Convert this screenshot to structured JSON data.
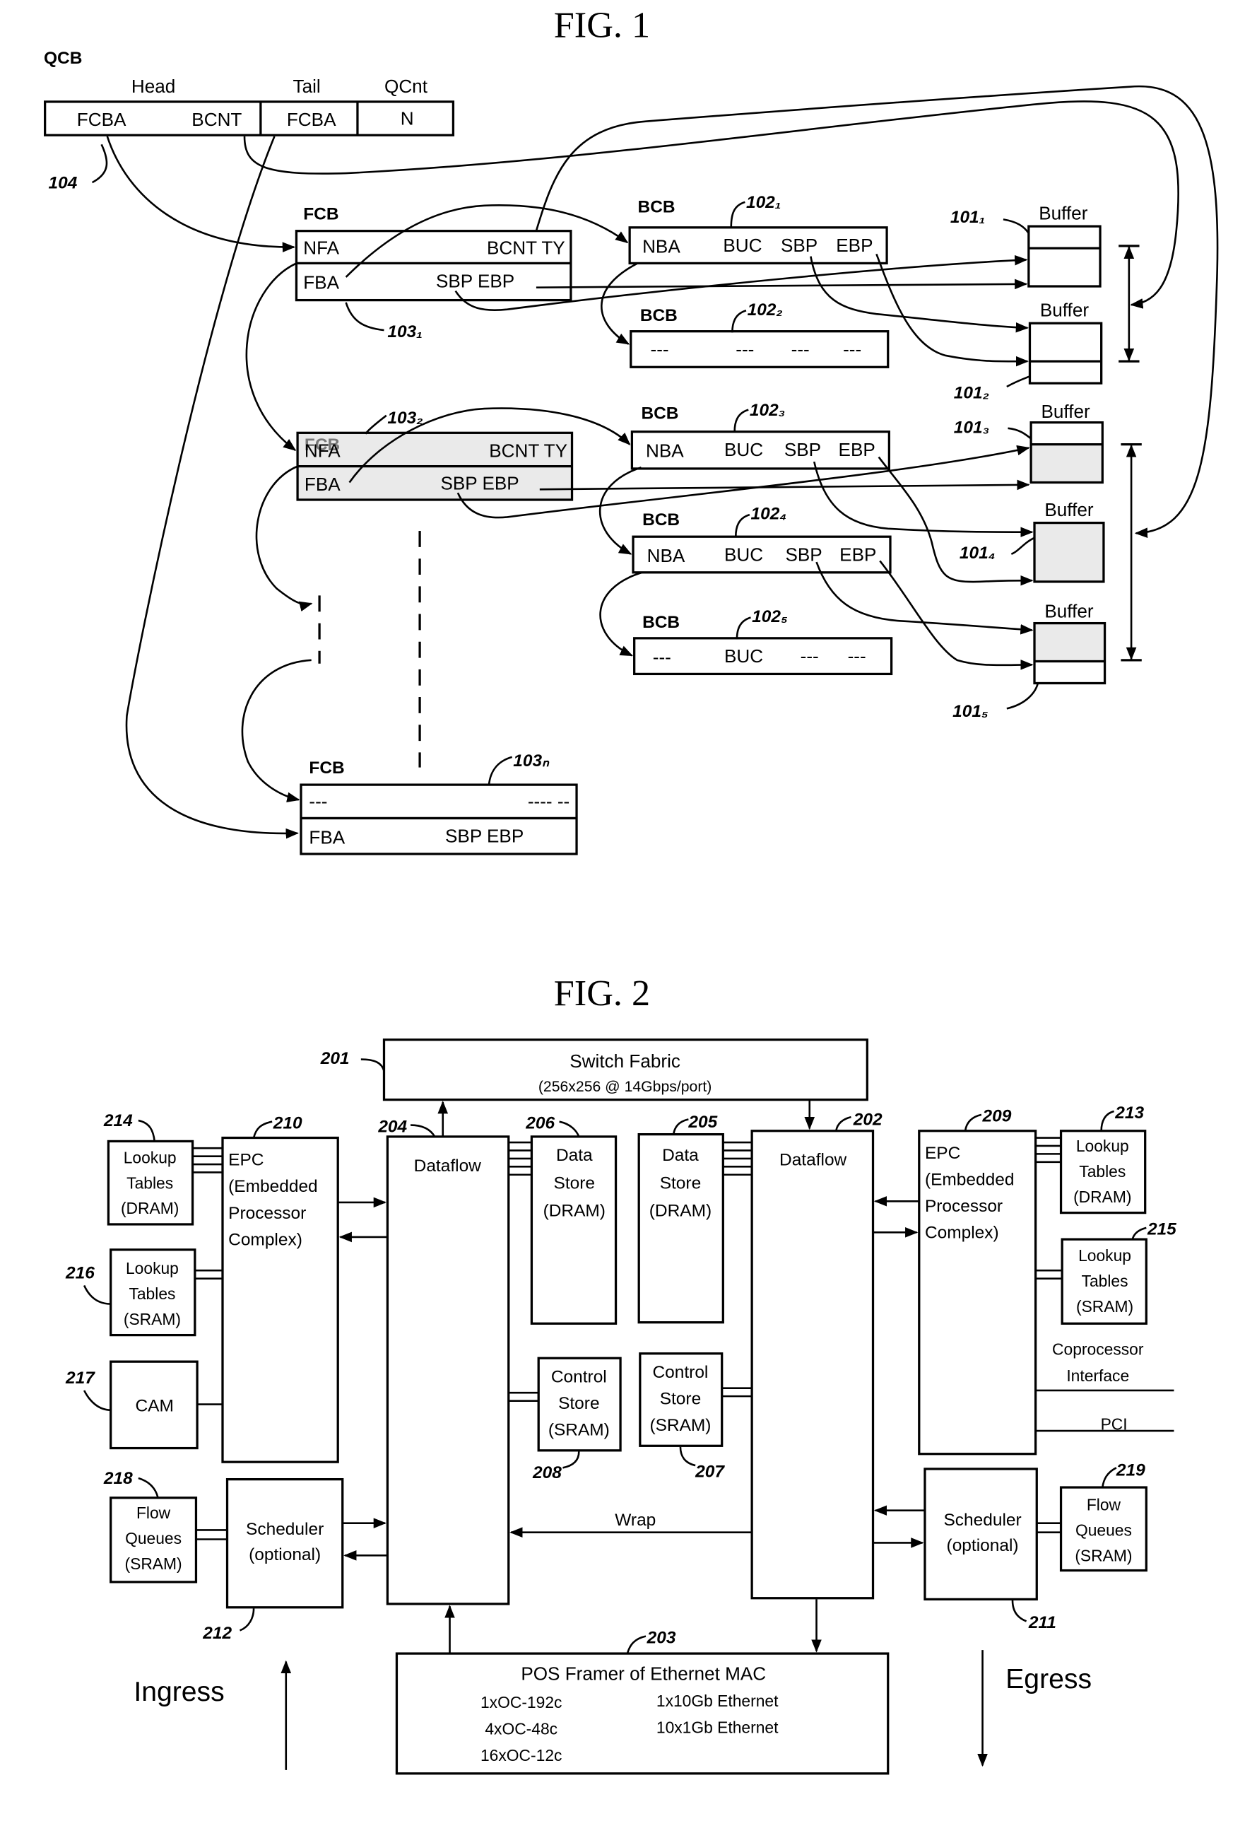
{
  "fig1": {
    "title": "FIG. 1",
    "qcb": {
      "label": "QCB",
      "headers": {
        "head": "Head",
        "tail": "Tail",
        "qcnt": "QCnt"
      },
      "fields": [
        "FCBA",
        "BCNT",
        "FCBA",
        "N"
      ],
      "ref": "104"
    },
    "fcbs": [
      {
        "label": "FCB",
        "ref": "103₁",
        "row1": [
          "NFA",
          "BCNT TY"
        ],
        "row2": [
          "FBA",
          "SBP EBP"
        ],
        "shaded": false
      },
      {
        "label": "FCB",
        "ref": "103₂",
        "row1": [
          "NFA",
          "BCNT TY"
        ],
        "row2": [
          "FBA",
          "SBP EBP"
        ],
        "shaded": true
      },
      {
        "label": "FCB",
        "ref": "103ₙ",
        "row1": [
          "---",
          "---- --"
        ],
        "row2": [
          "FBA",
          "SBP EBP"
        ],
        "shaded": false
      }
    ],
    "bcbs": [
      {
        "label": "BCB",
        "ref": "102₁",
        "fields": [
          "NBA",
          "BUC",
          "SBP",
          "EBP"
        ]
      },
      {
        "label": "BCB",
        "ref": "102₂",
        "fields": [
          "---",
          "---",
          "---",
          "---"
        ]
      },
      {
        "label": "BCB",
        "ref": "102₃",
        "fields": [
          "NBA",
          "BUC",
          "SBP",
          "EBP"
        ]
      },
      {
        "label": "BCB",
        "ref": "102₄",
        "fields": [
          "NBA",
          "BUC",
          "SBP",
          "EBP"
        ]
      },
      {
        "label": "BCB",
        "ref": "102₅",
        "fields": [
          "---",
          "BUC",
          "---",
          "---"
        ]
      }
    ],
    "buffers": [
      {
        "label": "Buffer",
        "ref": "101₁"
      },
      {
        "label": "Buffer",
        "ref": "101₂"
      },
      {
        "label": "Buffer",
        "ref": "101₃"
      },
      {
        "label": "Buffer",
        "ref": "101₄"
      },
      {
        "label": "Buffer",
        "ref": "101₅"
      }
    ]
  },
  "fig2": {
    "title": "FIG. 2",
    "switch_fabric": {
      "ref": "201",
      "title": "Switch Fabric",
      "subtitle": "(256x256 @ 14Gbps/port)"
    },
    "dataflow_ingress": {
      "ref": "204",
      "label": "Dataflow"
    },
    "dataflow_egress": {
      "ref": "202",
      "label": "Dataflow"
    },
    "data_store_left": {
      "ref": "206",
      "lines": [
        "Data",
        "Store",
        "(DRAM)"
      ]
    },
    "data_store_right": {
      "ref": "205",
      "lines": [
        "Data",
        "Store",
        "(DRAM)"
      ]
    },
    "control_store_left": {
      "ref": "208",
      "lines": [
        "Control",
        "Store",
        "(SRAM)"
      ]
    },
    "control_store_right": {
      "ref": "207",
      "lines": [
        "Control",
        "Store",
        "(SRAM)"
      ]
    },
    "epc_left": {
      "ref": "210",
      "lines": [
        "EPC",
        "(Embedded",
        "Processor",
        "Complex)"
      ]
    },
    "epc_right": {
      "ref": "209",
      "lines": [
        "EPC",
        "(Embedded",
        "Processor",
        "Complex)"
      ]
    },
    "lookup_dram_left": {
      "ref": "214",
      "lines": [
        "Lookup",
        "Tables",
        "(DRAM)"
      ]
    },
    "lookup_sram_left": {
      "ref": "216",
      "lines": [
        "Lookup",
        "Tables",
        "(SRAM)"
      ]
    },
    "lookup_dram_right": {
      "ref": "213",
      "lines": [
        "Lookup",
        "Tables",
        "(DRAM)"
      ]
    },
    "lookup_sram_right": {
      "ref": "215",
      "lines": [
        "Lookup",
        "Tables",
        "(SRAM)"
      ]
    },
    "cam": {
      "ref": "217",
      "label": "CAM"
    },
    "coprocessor": [
      "Coprocessor",
      "Interface"
    ],
    "pci": "PCI",
    "flow_queues_left": {
      "ref": "218",
      "lines": [
        "Flow",
        "Queues",
        "(SRAM)"
      ]
    },
    "flow_queues_right": {
      "ref": "219",
      "lines": [
        "Flow",
        "Queues",
        "(SRAM)"
      ]
    },
    "scheduler_left": {
      "ref": "212",
      "lines": [
        "Scheduler",
        "(optional)"
      ]
    },
    "scheduler_right": {
      "ref": "211",
      "lines": [
        "Scheduler",
        "(optional)"
      ]
    },
    "wrap": "Wrap",
    "pos": {
      "ref": "203",
      "title": "POS Framer of Ethernet MAC",
      "left": [
        "1xOC-192c",
        "4xOC-48c",
        "16xOC-12c"
      ],
      "right": [
        "1x10Gb Ethernet",
        "10x1Gb Ethernet"
      ]
    },
    "ingress": "Ingress",
    "egress": "Egress"
  }
}
